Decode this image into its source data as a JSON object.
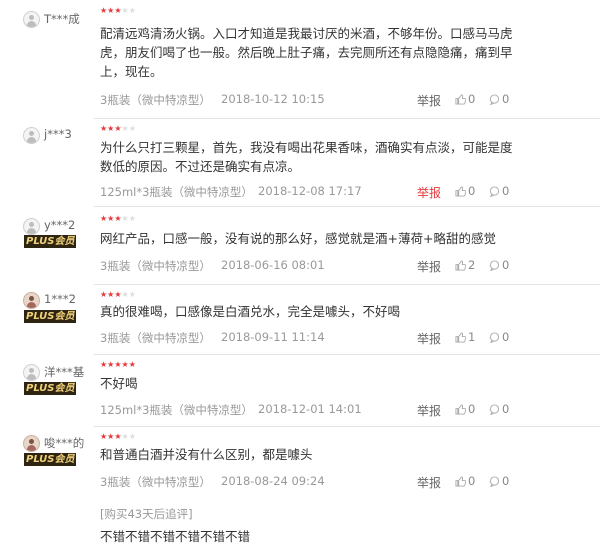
{
  "reviews": [
    {
      "user": "T***成",
      "plus": "",
      "text": "配清远鸡清汤火锅。入口才知道是我最讨厌的米酒，不够年份。口感马马虎虎，朋友们喝了也一般。然后晚上肚子痛，去完厕所还有点隐隐痛，痛到早上，现在。",
      "spec": "3瓶装（微中特凉型）",
      "date": "2018-10-12 10:15",
      "report": "举报",
      "likes": "0",
      "replies": "0",
      "stars": "3 of 5"
    },
    {
      "user": "j***3",
      "plus": "",
      "text": "为什么只打三颗星，首先，我没有喝出花果香味，酒确实有点淡，可能是度数低的原因。不过还是确实有点凉。",
      "spec": "125ml*3瓶装（微中特凉型）",
      "date": "2018-12-08 17:17",
      "report": "举报",
      "likes": "0",
      "replies": "0",
      "stars": "3 of 5"
    },
    {
      "user": "y***2",
      "plus": "PLUS会员",
      "text": "网红产品，口感一般，没有说的那么好，感觉就是酒+薄荷+略甜的感觉",
      "spec": "3瓶装（微中特凉型）",
      "date": "2018-06-16 08:01",
      "report": "举报",
      "likes": "2",
      "replies": "0",
      "stars": "3 of 5"
    },
    {
      "user": "1***2",
      "plus": "PLUS会员",
      "text": "真的很难喝，口感像是白酒兑水，完全是噱头，不好喝",
      "spec": "3瓶装（微中特凉型）",
      "date": "2018-09-11 11:14",
      "report": "举报",
      "likes": "1",
      "replies": "0",
      "stars": "3 of 5"
    },
    {
      "user": "洋***基",
      "plus": "PLUS会员",
      "text": "不好喝",
      "spec": "125ml*3瓶装（微中特凉型）",
      "date": "2018-12-01 14:01",
      "report": "举报",
      "likes": "0",
      "replies": "0",
      "stars": "5 of 5"
    },
    {
      "user": "唆***的",
      "plus": "PLUS会员",
      "text": "和普通白酒并没有什么区别，都是噱头",
      "spec": "3瓶装（微中特凉型）",
      "date": "2018-08-24 09:24",
      "report": "举报",
      "likes": "0",
      "replies": "0",
      "stars": "3 of 5",
      "followup_label": "[购买43天后追评]",
      "followup_text": "不错不错不错不错不错不错"
    }
  ],
  "colors": {
    "accent_red": "#e4393c",
    "meta_gray": "#999999",
    "plus_badge_bg": "#2e2412",
    "plus_badge_text": "#f1d27a"
  },
  "icons": {
    "like": "thumbs-up-icon",
    "reply": "comment-icon",
    "avatar": "user-avatar-icon"
  }
}
